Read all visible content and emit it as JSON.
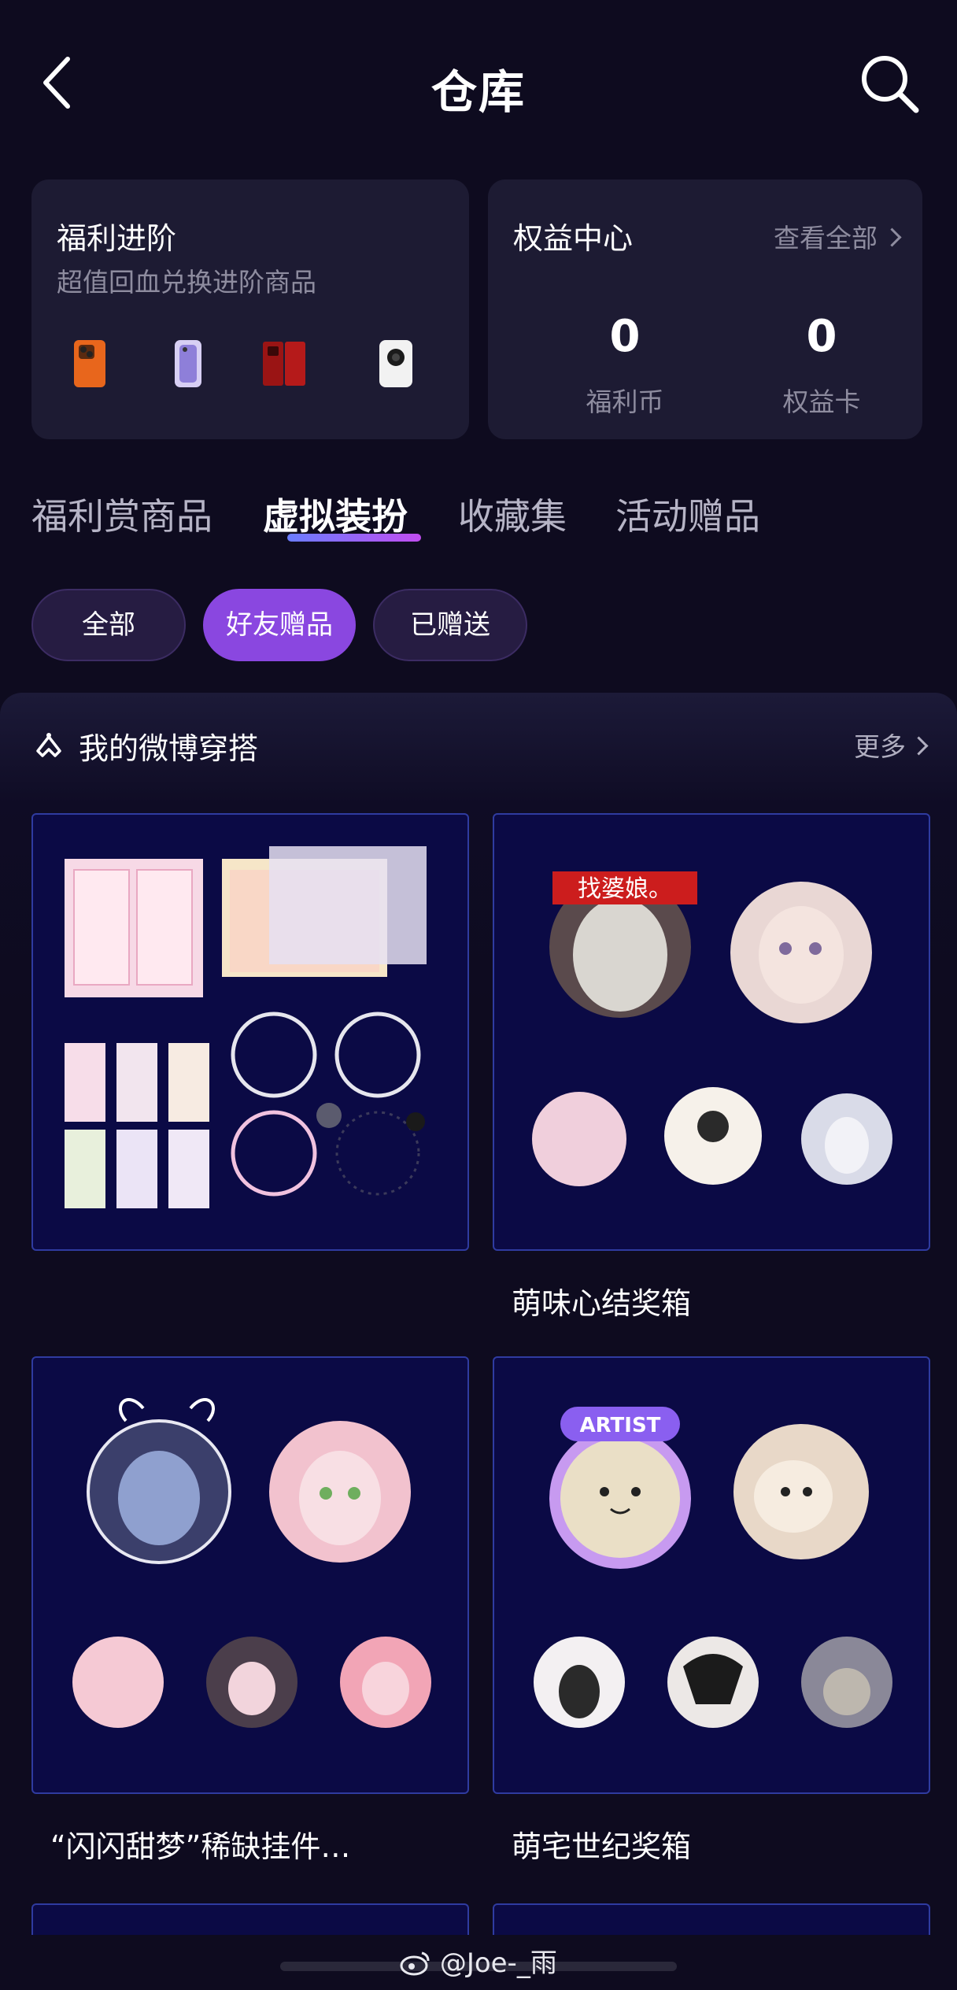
{
  "header": {
    "title": "仓库",
    "back_icon": "chevron-left-icon",
    "search_icon": "search-icon"
  },
  "welfare_card": {
    "title": "福利进阶",
    "subtitle": "超值回血兑换进阶商品",
    "products": [
      "orange-phone",
      "purple-phone",
      "red-foldable-phone",
      "white-phone"
    ]
  },
  "rights_card": {
    "title": "权益中心",
    "view_all": "查看全部",
    "stats": [
      {
        "value": "0",
        "label": "福利币"
      },
      {
        "value": "0",
        "label": "权益卡"
      }
    ]
  },
  "tabs": [
    {
      "label": "福利赏商品",
      "active": false
    },
    {
      "label": "虚拟装扮",
      "active": true
    },
    {
      "label": "收藏集",
      "active": false
    },
    {
      "label": "活动赠品",
      "active": false
    }
  ],
  "filters": [
    {
      "label": "全部",
      "active": false
    },
    {
      "label": "好友赠品",
      "active": true
    },
    {
      "label": "已赠送",
      "active": false
    }
  ],
  "section": {
    "title": "我的微博穿搭",
    "more": "更多",
    "items": [
      {
        "label": ""
      },
      {
        "label": "萌味心结奖箱"
      },
      {
        "label": "“闪闪甜梦”稀缺挂件…"
      },
      {
        "label": "萌宅世纪奖箱"
      }
    ]
  },
  "watermark": "@Joe-_雨",
  "colors": {
    "background": "#0e0b1f",
    "card": "#1d1b33",
    "accent": "#8a47e0",
    "thumb_bg": "#0b0a45",
    "muted_text": "#8e8c9f"
  }
}
